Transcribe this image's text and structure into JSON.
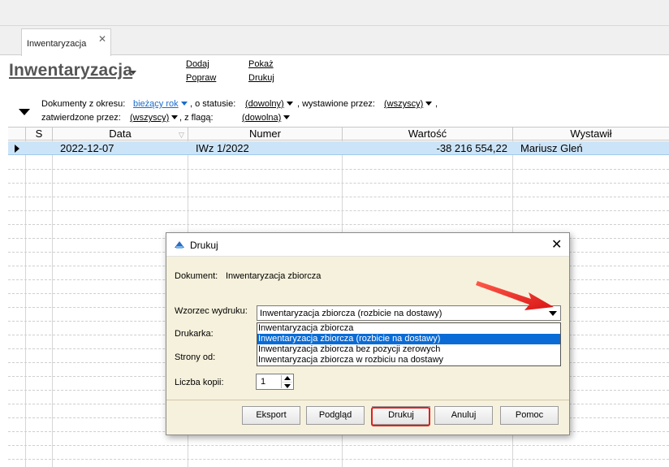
{
  "tab": {
    "label": "Inwentaryzacja",
    "close_glyph": "✕"
  },
  "header": {
    "title": "Inwentaryzacja",
    "actions": {
      "add": "Dodaj",
      "edit": "Popraw",
      "show": "Pokaż",
      "print": "Drukuj"
    }
  },
  "filters": {
    "period_label": "Dokumenty z okresu:",
    "period_value": "bieżący rok",
    "status_label": ", o statusie:",
    "status_value": "(dowolny)",
    "issued_label": ", wystawione przez:",
    "issued_value": "(wszyscy)",
    "trailing_comma": ",",
    "approved_label": "zatwierdzone przez:",
    "approved_value": "(wszyscy)",
    "flag_label": ", z flagą:",
    "flag_value": "(dowolna)"
  },
  "grid": {
    "columns": [
      "S",
      "Data",
      "Numer",
      "Wartość",
      "Wystawił"
    ],
    "rows": [
      {
        "s": "",
        "date": "2022-12-07",
        "number": "IWz 1/2022",
        "value": "-38 216 554,22",
        "issued_by": "Mariusz Gleń"
      }
    ]
  },
  "dialog": {
    "title": "Drukuj",
    "close_glyph": "✕",
    "document_label": "Dokument:",
    "document_value": "Inwentaryzacja zbiorcza",
    "template_label": "Wzorzec wydruku:",
    "template_value": "Inwentaryzacja zbiorcza (rozbicie na dostawy)",
    "template_options": [
      "Inwentaryzacja zbiorcza",
      "Inwentaryzacja zbiorcza (rozbicie na dostawy)",
      "Inwentaryzacja zbiorcza bez pozycji zerowych",
      "Inwentaryzacja zbiorcza w rozbiciu na dostawy"
    ],
    "selected_option_index": 1,
    "printer_label": "Drukarka:",
    "pages_label": "Strony od:",
    "copies_label": "Liczba kopii:",
    "copies_value": "1",
    "buttons": {
      "export": "Eksport",
      "preview": "Podgląd",
      "print": "Drukuj",
      "cancel": "Anuluj",
      "help": "Pomoc"
    }
  },
  "colors": {
    "selection_row": "#cce4f7",
    "dialog_background": "#f6f1dc",
    "dropdown_selected": "#0a6bd6",
    "annotation_red": "#e02020",
    "filter_link": "#1a6ccc"
  }
}
